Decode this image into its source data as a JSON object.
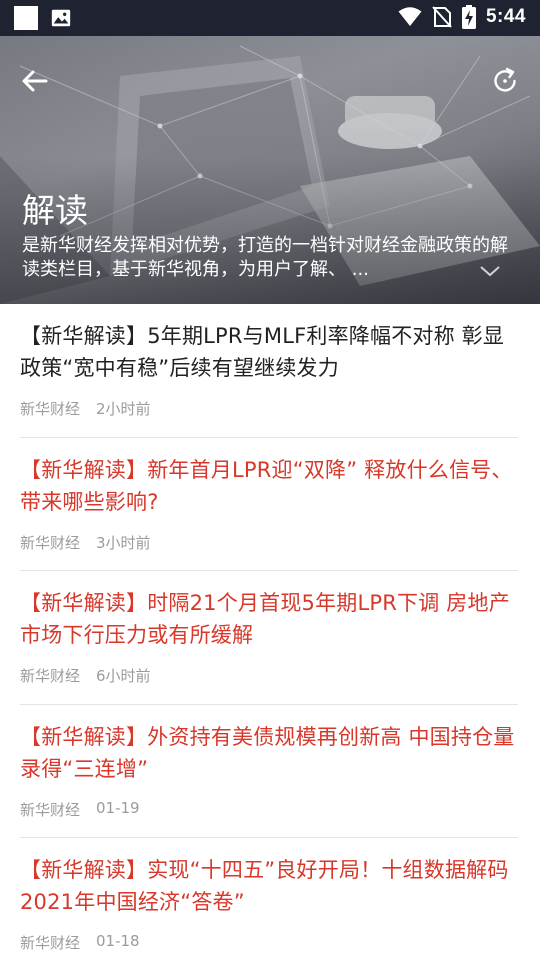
{
  "status_bar": {
    "time": "5:44",
    "icons": [
      "notification-square-icon",
      "image-icon",
      "wifi-icon",
      "no-sim-icon",
      "battery-charging-icon"
    ]
  },
  "header": {
    "title": "解读",
    "description": "是新华财经发挥相对优势，打造的一档针对财经金融政策的解读类栏目，基于新华视角，为用户了解、 ...",
    "icons": {
      "back": "arrow-left-icon",
      "refresh": "refresh-icon",
      "expand": "chevron-down-icon"
    },
    "text_color": "#ffffff"
  },
  "articles": [
    {
      "title": "【新华解读】5年期LPR与MLF利率降幅不对称 彰显政策“宽中有稳”后续有望继续发力",
      "source": "新华财经",
      "time": "2小时前",
      "read": true
    },
    {
      "title": "【新华解读】新年首月LPR迎“双降” 释放什么信号、带来哪些影响?",
      "source": "新华财经",
      "time": "3小时前",
      "read": false
    },
    {
      "title": "【新华解读】时隔21个月首现5年期LPR下调 房地产市场下行压力或有所缓解",
      "source": "新华财经",
      "time": "6小时前",
      "read": false
    },
    {
      "title": "【新华解读】外资持有美债规模再创新高 中国持仓量录得“三连增”",
      "source": "新华财经",
      "time": "01-19",
      "read": false
    },
    {
      "title": "【新华解读】实现“十四五”良好开局！十组数据解码2021年中国经济“答卷”",
      "source": "新华财经",
      "time": "01-18",
      "read": false
    }
  ],
  "colors": {
    "unread_title": "#d8372a",
    "read_title": "#222222",
    "meta": "#9b9b9b",
    "status_bar": "#1f2230"
  }
}
